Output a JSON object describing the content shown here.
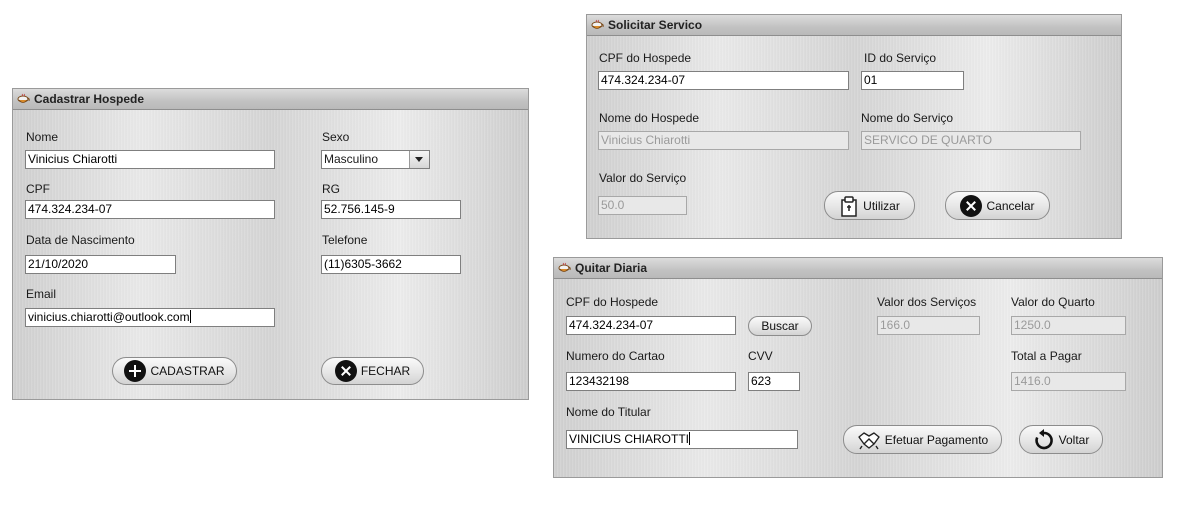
{
  "cadastrar": {
    "title": "Cadastrar Hospede",
    "nome_label": "Nome",
    "nome_value": "Vinicius Chiarotti",
    "sexo_label": "Sexo",
    "sexo_value": "Masculino",
    "cpf_label": "CPF",
    "cpf_value": "474.324.234-07",
    "rg_label": "RG",
    "rg_value": "52.756.145-9",
    "nascimento_label": "Data de Nascimento",
    "nascimento_value": "21/10/2020",
    "telefone_label": "Telefone",
    "telefone_value": "(11)6305-3662",
    "email_label": "Email",
    "email_value": "vinicius.chiarotti@outlook.com",
    "cadastrar_button": "CADASTRAR",
    "fechar_button": "FECHAR"
  },
  "servico": {
    "title": "Solicitar Servico",
    "cpf_label": "CPF do Hospede",
    "cpf_value": "474.324.234-07",
    "id_label": "ID do Serviço",
    "id_value": "01",
    "nome_hospede_label": "Nome do Hospede",
    "nome_hospede_value": "Vinicius Chiarotti",
    "nome_servico_label": "Nome do Serviço",
    "nome_servico_value": "SERVICO DE QUARTO",
    "valor_label": "Valor do Serviço",
    "valor_value": "50.0",
    "utilizar_button": "Utilizar",
    "cancelar_button": "Cancelar"
  },
  "diaria": {
    "title": "Quitar Diaria",
    "cpf_label": "CPF do Hospede",
    "cpf_value": "474.324.234-07",
    "buscar_button": "Buscar",
    "valor_servicos_label": "Valor dos Serviços",
    "valor_servicos_value": "166.0",
    "valor_quarto_label": "Valor do Quarto",
    "valor_quarto_value": "1250.0",
    "cartao_label": "Numero do Cartao",
    "cartao_value": "123432198",
    "cvv_label": "CVV",
    "cvv_value": "623",
    "total_label": "Total a Pagar",
    "total_value": "1416.0",
    "titular_label": "Nome do Titular",
    "titular_value": "VINICIUS CHIAROTTI",
    "pagamento_button": "Efetuar Pagamento",
    "voltar_button": "Voltar"
  },
  "icons": {
    "window": "java-cup-icon",
    "cadastrar": "plus-circle-icon",
    "fechar": "close-circle-icon",
    "utilizar": "clipboard-icon",
    "cancelar": "close-circle-icon",
    "pagamento": "handshake-icon",
    "voltar": "refresh-icon"
  }
}
